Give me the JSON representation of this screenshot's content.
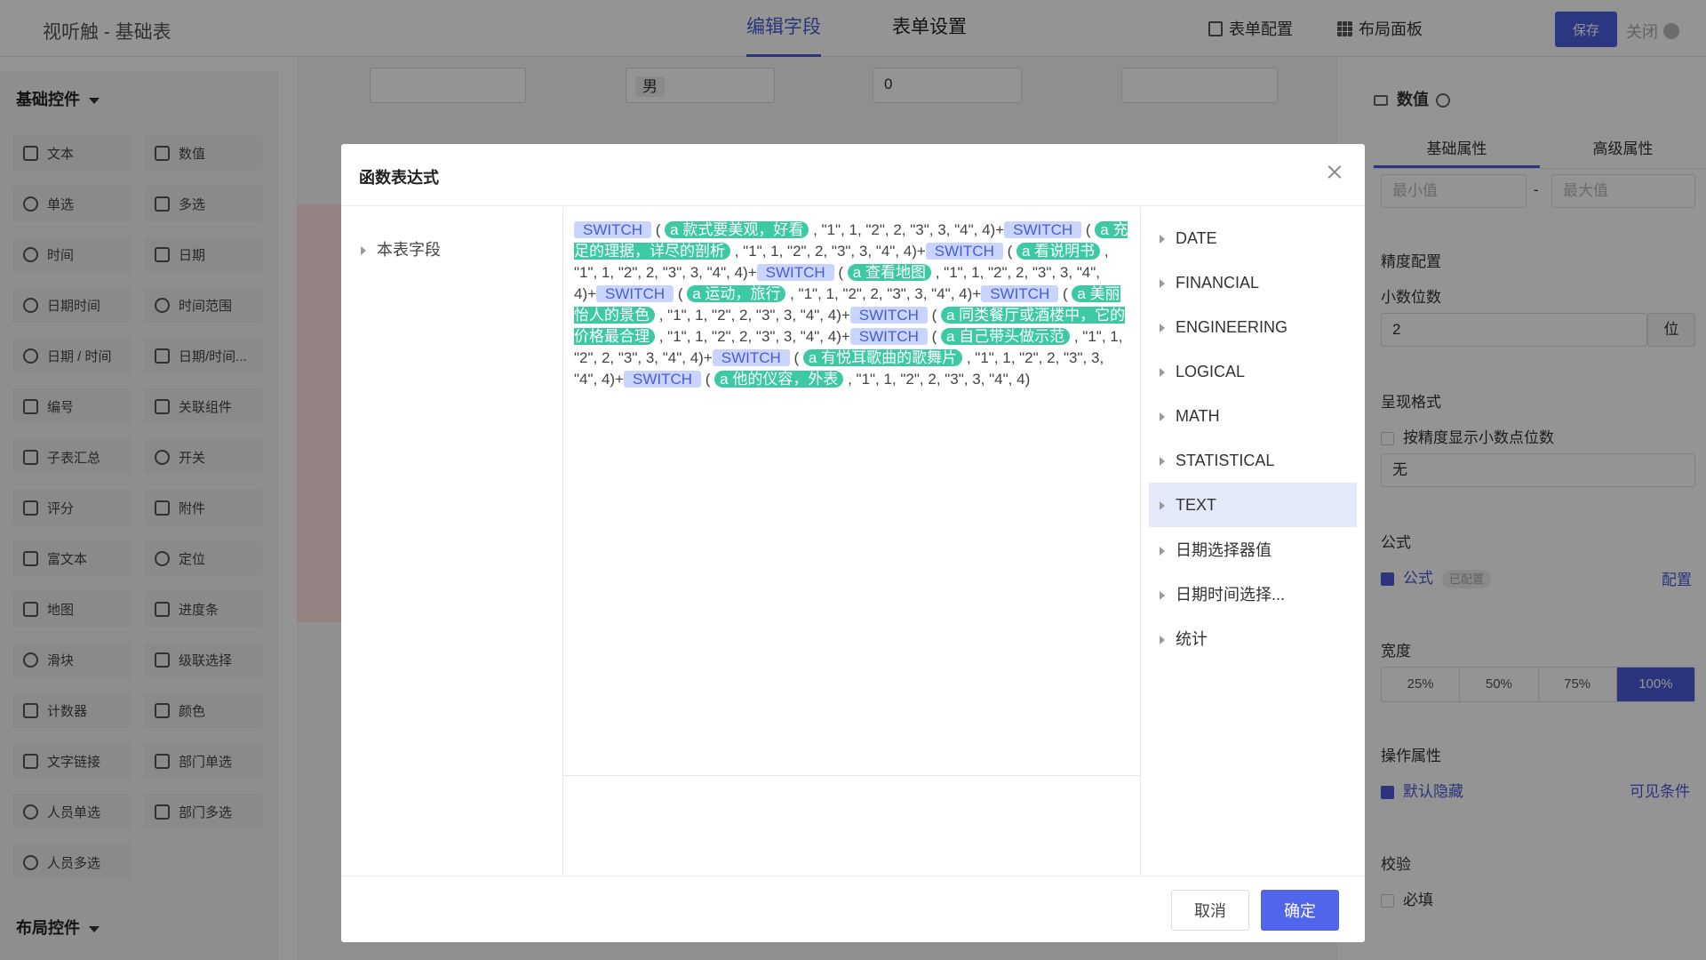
{
  "topbar": {
    "app_title": "视听触 - 基础表",
    "tabs": [
      {
        "label": "编辑字段"
      },
      {
        "label": "表单设置"
      }
    ],
    "actions": [
      {
        "label": "表单配置",
        "icon": "form-config-icon"
      },
      {
        "label": "布局面板",
        "icon": "grid-icon"
      }
    ],
    "save_label": "保存",
    "close_label": "关闭"
  },
  "left_panel": {
    "basic_title": "基础控件",
    "controls": [
      {
        "label": "文本"
      },
      {
        "label": "数值"
      },
      {
        "label": "单选"
      },
      {
        "label": "多选"
      },
      {
        "label": "时间"
      },
      {
        "label": "日期"
      },
      {
        "label": "日期时间"
      },
      {
        "label": "时间范围"
      },
      {
        "label": "日期 / 时间"
      },
      {
        "label": "日期/时间..."
      },
      {
        "label": "编号"
      },
      {
        "label": "关联组件"
      },
      {
        "label": "子表汇总"
      },
      {
        "label": "开关"
      },
      {
        "label": "评分"
      },
      {
        "label": "附件"
      },
      {
        "label": "富文本"
      },
      {
        "label": "定位"
      },
      {
        "label": "地图"
      },
      {
        "label": "进度条"
      },
      {
        "label": "滑块"
      },
      {
        "label": "级联选择"
      },
      {
        "label": "计数器"
      },
      {
        "label": "颜色"
      },
      {
        "label": "文字链接"
      },
      {
        "label": "部门单选"
      },
      {
        "label": "人员单选"
      },
      {
        "label": "部门多选"
      },
      {
        "label": "人员多选"
      }
    ],
    "layout_title": "布局控件"
  },
  "canvas": {
    "fields": [
      {
        "value": ""
      },
      {
        "value": "男"
      },
      {
        "value": "0"
      },
      {
        "value": ""
      }
    ]
  },
  "right_panel": {
    "title": "数值",
    "tabs": [
      {
        "label": "基础属性"
      },
      {
        "label": "高级属性"
      }
    ],
    "min_placeholder": "最小值",
    "max_placeholder": "最大值",
    "range_sep": "-",
    "precision_title": "精度配置",
    "decimal_label": "小数位数",
    "decimal_value": "2",
    "decimal_unit": "位",
    "format_title": "呈现格式",
    "format_checkbox": "按精度显示小数点位数",
    "format_select": "无",
    "formula_title": "公式",
    "formula_checkbox": "公式",
    "formula_badge": "已配置",
    "formula_link": "配置",
    "width_title": "宽度",
    "widths": [
      "25%",
      "50%",
      "75%",
      "100%"
    ],
    "ops_title": "操作属性",
    "hidden_label": "默认隐藏",
    "visible_link": "可见条件",
    "validate_title": "校验",
    "required_label": "必填"
  },
  "modal": {
    "title": "函数表达式",
    "tree_item": "本表字段",
    "categories": [
      {
        "label": "DATE"
      },
      {
        "label": "FINANCIAL"
      },
      {
        "label": "ENGINEERING"
      },
      {
        "label": "LOGICAL"
      },
      {
        "label": "MATH"
      },
      {
        "label": "STATISTICAL"
      },
      {
        "label": "TEXT"
      },
      {
        "label": "日期选择器值"
      },
      {
        "label": "日期时间选择..."
      },
      {
        "label": "统计"
      }
    ],
    "active_category": "TEXT",
    "expression": [
      {
        "fn": "SWITCH",
        "field": "a 款式要美观，好看"
      },
      {
        "fn": "SWITCH",
        "field": "a 充足的理据，详尽的剖析"
      },
      {
        "fn": "SWITCH",
        "field": "a 看说明书"
      },
      {
        "fn": "SWITCH",
        "field": "a 查看地图"
      },
      {
        "fn": "SWITCH",
        "field": "a 运动，旅行"
      },
      {
        "fn": "SWITCH",
        "field": "a 美丽怡人的景色"
      },
      {
        "fn": "SWITCH",
        "field": "a 同类餐厅或酒楼中，它的价格最合理"
      },
      {
        "fn": "SWITCH",
        "field": "a 自己带头做示范"
      },
      {
        "fn": "SWITCH",
        "field": "a 有悦耳歌曲的歌舞片"
      },
      {
        "fn": "SWITCH",
        "field": "a 他的仪容，外表"
      }
    ],
    "args": ", \"1\", 1, \"2\", 2, \"3\", 3, \"4\", 4)",
    "joiner": "+",
    "cancel_label": "取消",
    "ok_label": "确定"
  }
}
